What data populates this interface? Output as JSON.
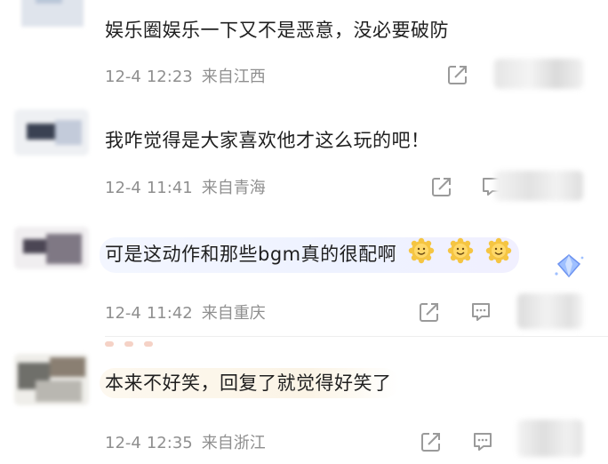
{
  "comments": [
    {
      "text": "娱乐圈娱乐一下又不是恶意，没必要破防",
      "date": "12-4",
      "time": "12:23",
      "location": "来自江西"
    },
    {
      "text": "我咋觉得是大家喜欢他才这么玩的吧！",
      "date": "12-4",
      "time": "11:41",
      "location": "来自青海"
    },
    {
      "text": "可是这动作和那些bgm真的很配啊",
      "emoji_count": 3,
      "date": "12-4",
      "time": "11:42",
      "location": "来自重庆"
    },
    {
      "text": "本来不好笑，回复了就觉得好笑了",
      "date": "12-4",
      "time": "12:35",
      "location": "来自浙江"
    }
  ],
  "icons": {
    "share": "share-icon",
    "reply": "comment-icon",
    "emoji": "smiling-sun-emoji",
    "badge": "diamond-badge-icon"
  },
  "colors": {
    "text": "#1f1f1f",
    "meta": "#8f8f8f",
    "icon": "#9a9a9a",
    "bubble_blue": "#eef2ff",
    "bubble_yellow": "#fbf4e6"
  }
}
